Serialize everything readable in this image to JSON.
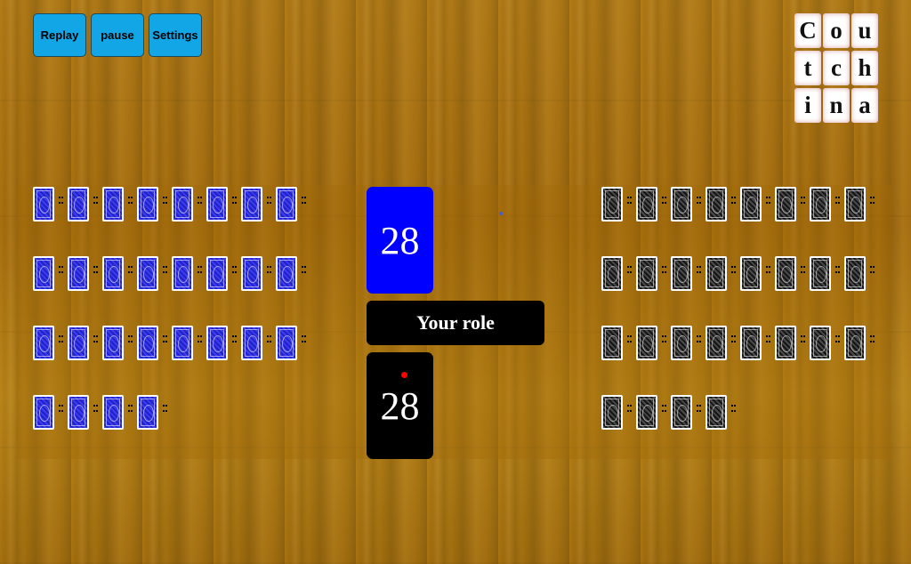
{
  "toolbar": {
    "replay_label": "Replay",
    "pause_label": "pause",
    "settings_label": "Settings"
  },
  "logo": {
    "letters": [
      "C",
      "o",
      "u",
      "t",
      "c",
      "h",
      "i",
      "n",
      "a"
    ]
  },
  "player_piles": {
    "left": {
      "card_back": "blue",
      "card_count": 28
    },
    "right": {
      "card_back": "black",
      "card_count": 28
    }
  },
  "counters": {
    "top": {
      "value": "28",
      "color": "#0000ff"
    },
    "bottom": {
      "value": "28",
      "color": "#000000",
      "indicator_color": "#ff0000"
    }
  },
  "role_label": "Your role",
  "colors": {
    "button": "#12a6e6",
    "table": "#b37c17"
  }
}
